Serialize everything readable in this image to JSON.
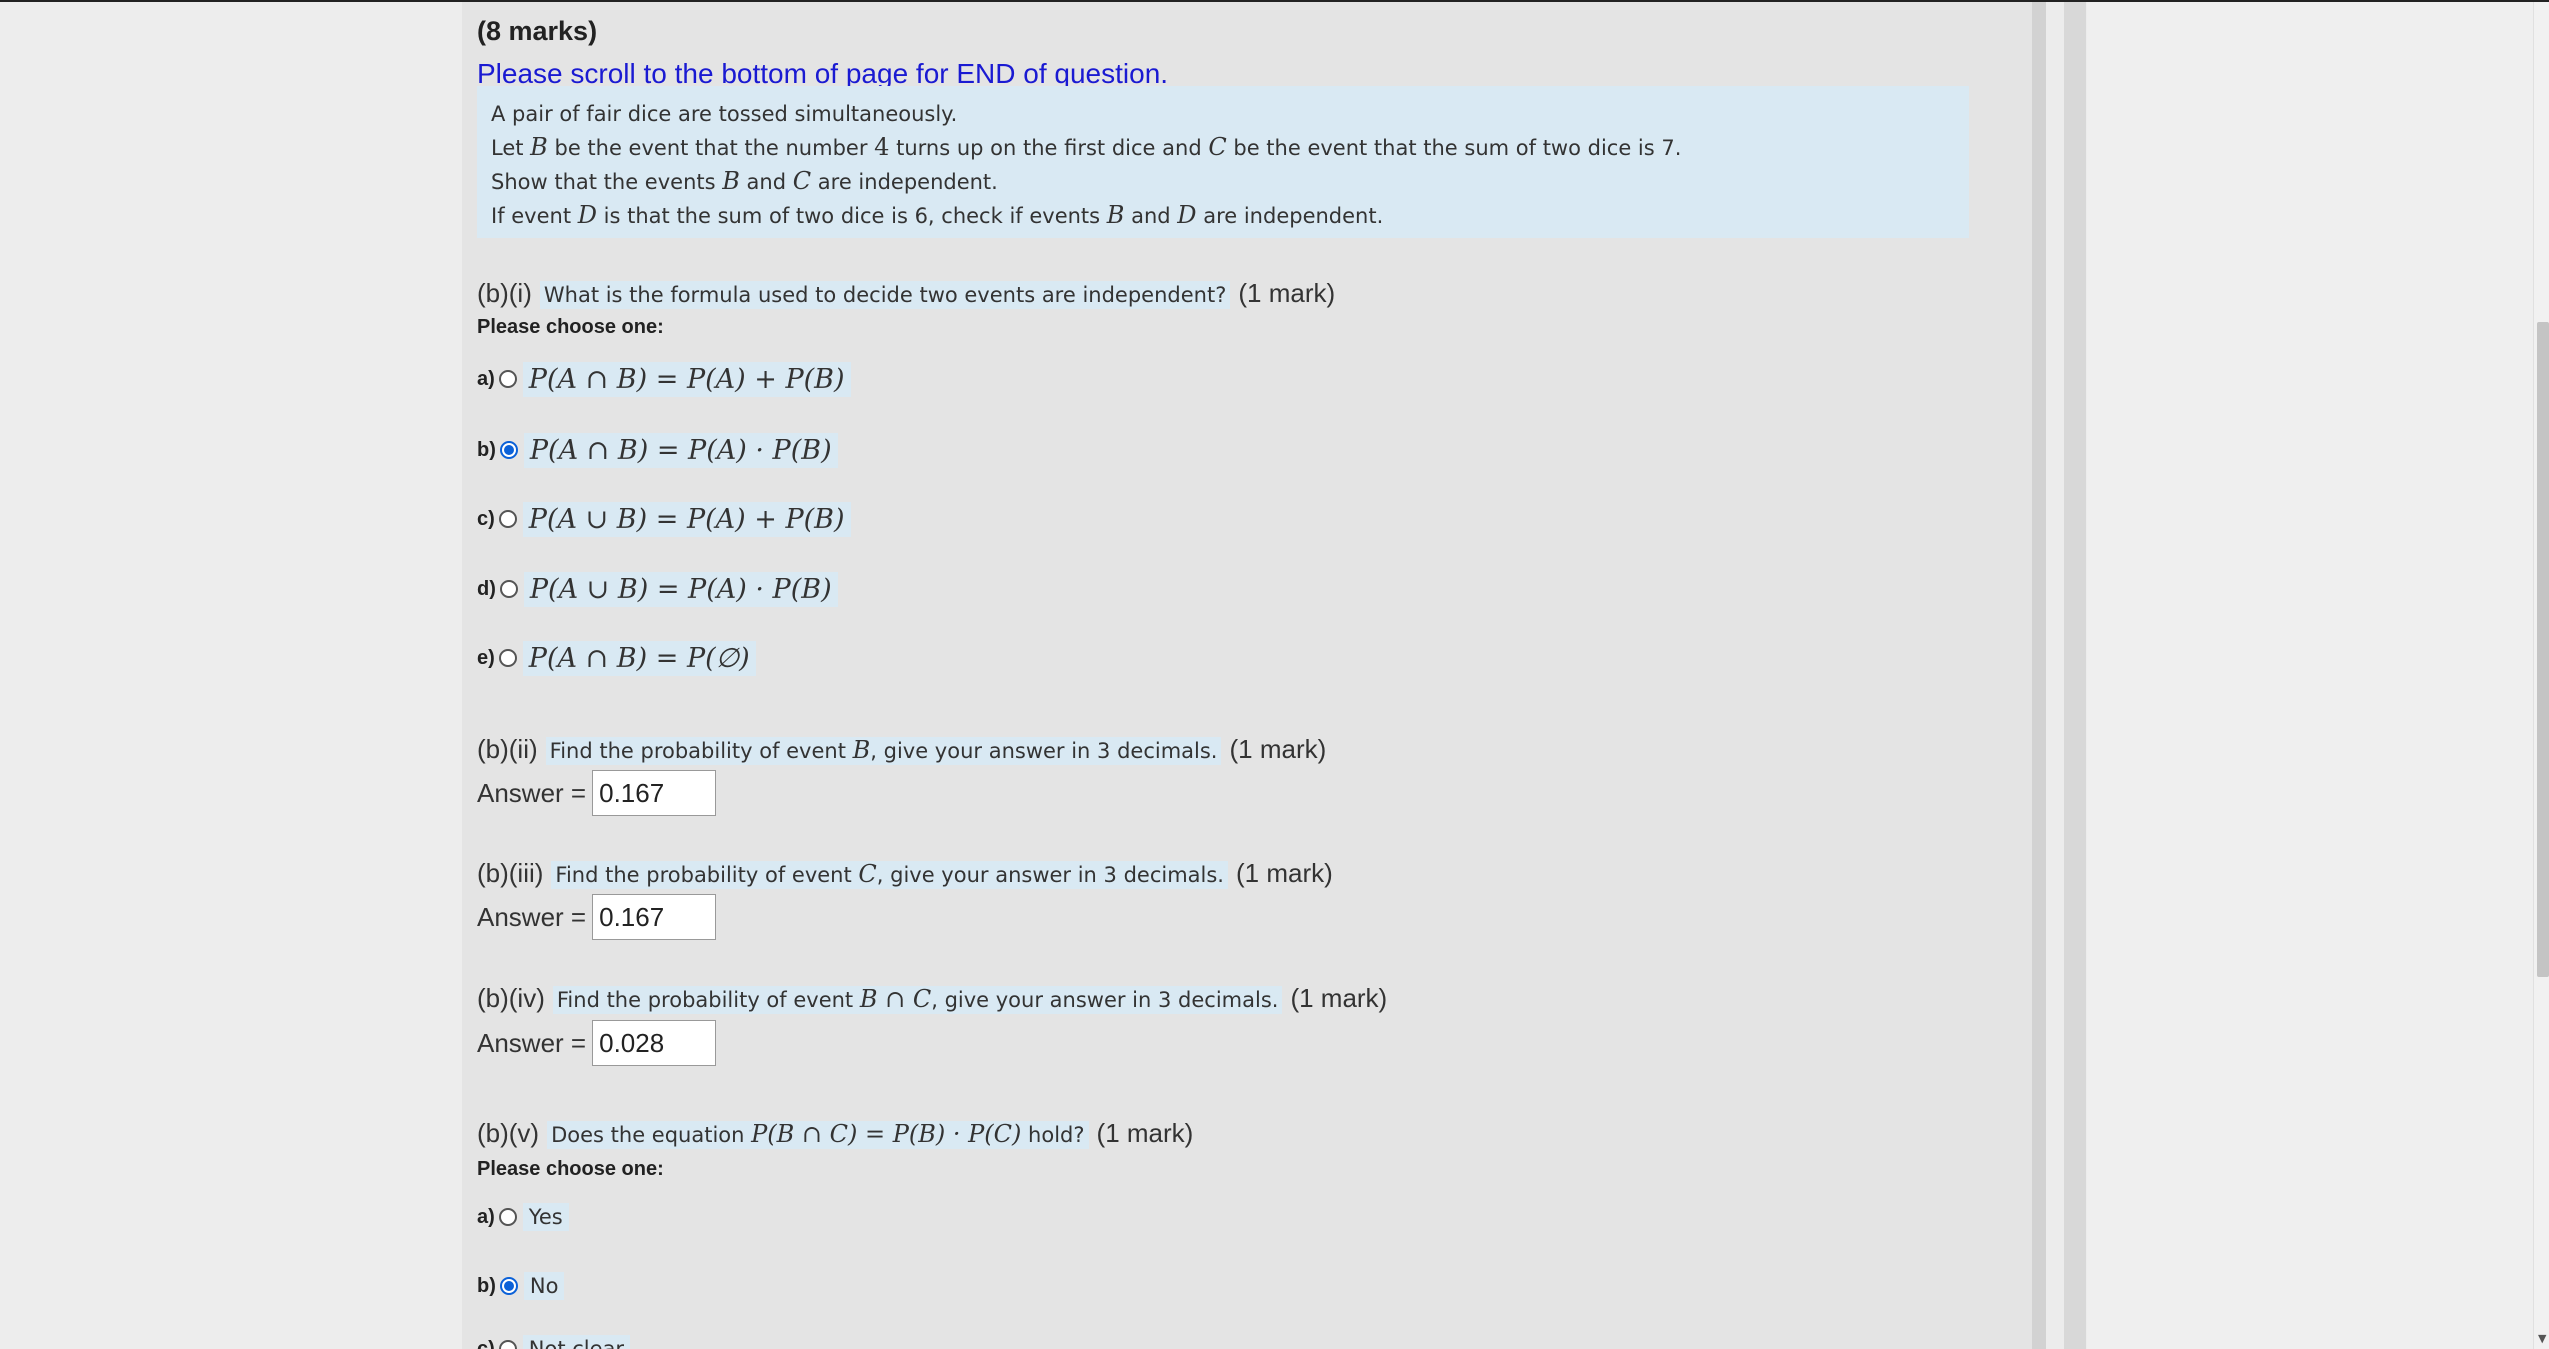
{
  "header": {
    "marks": "(8 marks)",
    "scroll_note": "Please scroll to the bottom of page for END of question."
  },
  "question": {
    "line1": "A pair of fair dice are tossed simultaneously.",
    "line2": {
      "a": "Let ",
      "b": "B",
      "c": " be the event that the number ",
      "d": "4",
      "e": " turns up on the first dice and ",
      "f": "C",
      "g": " be the event that the sum of two dice is 7."
    },
    "line3": {
      "a": "Show that the events ",
      "b": "B",
      "c": " and ",
      "d": "C",
      "e": " are independent."
    },
    "line4": {
      "a": "If event ",
      "b": "D",
      "c": " is that the sum of two dice is 6, check if events ",
      "d": "B",
      "e": " and ",
      "f": "D",
      "g": " are independent."
    }
  },
  "part_bi": {
    "number": "(b)(i)",
    "text": "What is the formula used to decide two events are independent?",
    "marks": "(1 mark)",
    "choose": "Please choose one:",
    "options": [
      {
        "letter": "a)",
        "text": "P(A ∩ B) = P(A) + P(B)",
        "checked": false
      },
      {
        "letter": "b)",
        "text": "P(A ∩ B) = P(A) · P(B)",
        "checked": true
      },
      {
        "letter": "c)",
        "text": "P(A ∪ B) = P(A) + P(B)",
        "checked": false
      },
      {
        "letter": "d)",
        "text": "P(A ∪ B) = P(A) · P(B)",
        "checked": false
      },
      {
        "letter": "e)",
        "text": "P(A ∩ B) = P(∅)",
        "checked": false
      }
    ]
  },
  "part_bii": {
    "number": "(b)(ii)",
    "text_a": "Find the probability of event ",
    "text_m": "B",
    "text_b": ", give your answer in 3 decimals.",
    "marks": "(1 mark)",
    "answer_label": "Answer =",
    "answer_value": "0.167"
  },
  "part_biii": {
    "number": "(b)(iii)",
    "text_a": "Find the probability of event ",
    "text_m": "C",
    "text_b": ", give your answer in 3 decimals.",
    "marks": "(1 mark)",
    "answer_label": "Answer =",
    "answer_value": "0.167"
  },
  "part_biv": {
    "number": "(b)(iv)",
    "text_a": "Find the probability of event ",
    "text_m": "B ∩ C",
    "text_b": ", give your answer in 3 decimals.",
    "marks": "(1 mark)",
    "answer_label": "Answer =",
    "answer_value": "0.028"
  },
  "part_bv": {
    "number": "(b)(v)",
    "text_a": "Does the equation ",
    "text_m": "P(B ∩ C) = P(B) · P(C)",
    "text_b": " hold?",
    "marks": "(1 mark)",
    "choose": "Please choose one:",
    "options": [
      {
        "letter": "a)",
        "text": "Yes",
        "checked": false
      },
      {
        "letter": "b)",
        "text": "No",
        "checked": true
      },
      {
        "letter": "c)",
        "text": "Not clear",
        "checked": false
      }
    ]
  }
}
